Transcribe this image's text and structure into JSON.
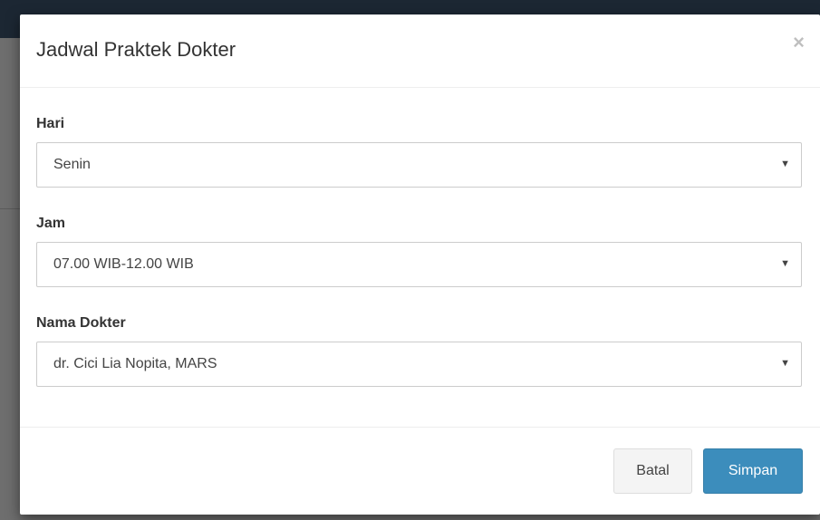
{
  "modal": {
    "title": "Jadwal Praktek Dokter",
    "close_symbol": "×"
  },
  "form": {
    "hari": {
      "label": "Hari",
      "value": "Senin"
    },
    "jam": {
      "label": "Jam",
      "value": "07.00 WIB-12.00 WIB"
    },
    "dokter": {
      "label": "Nama Dokter",
      "value": "dr. Cici Lia Nopita, MARS"
    },
    "dropdown_arrow": "▼"
  },
  "footer": {
    "cancel_label": "Batal",
    "save_label": "Simpan"
  },
  "colors": {
    "primary": "#3c8dbc",
    "overlay": "#6e6e6e",
    "topbar": "#1c2733"
  },
  "icons": {
    "close": "close-icon",
    "dropdown": "chevron-down-icon"
  }
}
